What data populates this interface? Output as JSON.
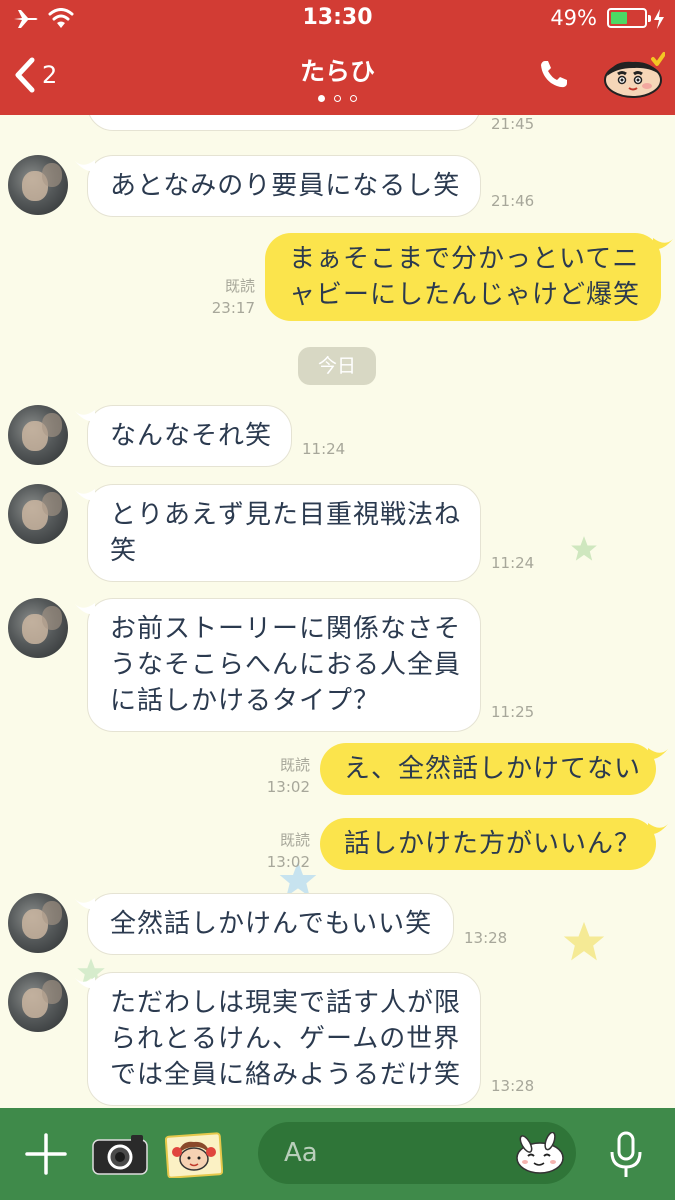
{
  "status_bar": {
    "time": "13:30",
    "battery_percent": "49%",
    "battery_level": 0.49
  },
  "header": {
    "back_count": "2",
    "title": "たらひ",
    "page_count": 3,
    "page_active": 0
  },
  "chat": {
    "partial_top_time": "21:45",
    "date_separator": "今日",
    "messages": [
      {
        "side": "in",
        "lines": [
          "あとなみのり要員になるし笑"
        ],
        "time": "21:46"
      },
      {
        "side": "out",
        "lines": [
          "まぁそこまで分かっといてニ",
          "ャビーにしたんじゃけど爆笑"
        ],
        "read": "既読",
        "time": "23:17"
      },
      {
        "side": "in",
        "lines": [
          "なんなそれ笑"
        ],
        "time": "11:24"
      },
      {
        "side": "in",
        "lines": [
          "とりあえず見た目重視戦法ね",
          "笑"
        ],
        "time": "11:24"
      },
      {
        "side": "in",
        "lines": [
          "お前ストーリーに関係なさそ",
          "うなそこらへんにおる人全員",
          "に話しかけるタイプ？"
        ],
        "time": "11:25"
      },
      {
        "side": "out",
        "lines": [
          "え、全然話しかけてない"
        ],
        "read": "既読",
        "time": "13:02"
      },
      {
        "side": "out",
        "lines": [
          "話しかけた方がいいん？"
        ],
        "read": "既読",
        "time": "13:02"
      },
      {
        "side": "in",
        "lines": [
          "全然話しかけんでもいい笑"
        ],
        "time": "13:28"
      },
      {
        "side": "in",
        "lines": [
          "ただわしは現実で話す人が限",
          "られとるけん、ゲームの世界",
          "では全員に絡みようるだけ笑"
        ],
        "time": "13:28"
      }
    ]
  },
  "input": {
    "placeholder": "Aa"
  },
  "colors": {
    "header": "#d23c34",
    "chat_background": "#fbfbe9",
    "outgoing_bubble": "#fbe44c",
    "incoming_bubble": "#ffffff",
    "input_bar": "#3f8a4a",
    "battery_fill": "#4cd964"
  },
  "icons": {
    "status_left": [
      "airplane-icon",
      "wifi-icon"
    ],
    "status_right": [
      "battery-icon",
      "charging-icon"
    ],
    "header": [
      "back-chevron-icon",
      "phone-icon",
      "shin-chan-sticker-icon"
    ],
    "bottom": [
      "plus-icon",
      "camera-icon",
      "sticker-icon",
      "emoji-icon",
      "microphone-icon"
    ]
  }
}
